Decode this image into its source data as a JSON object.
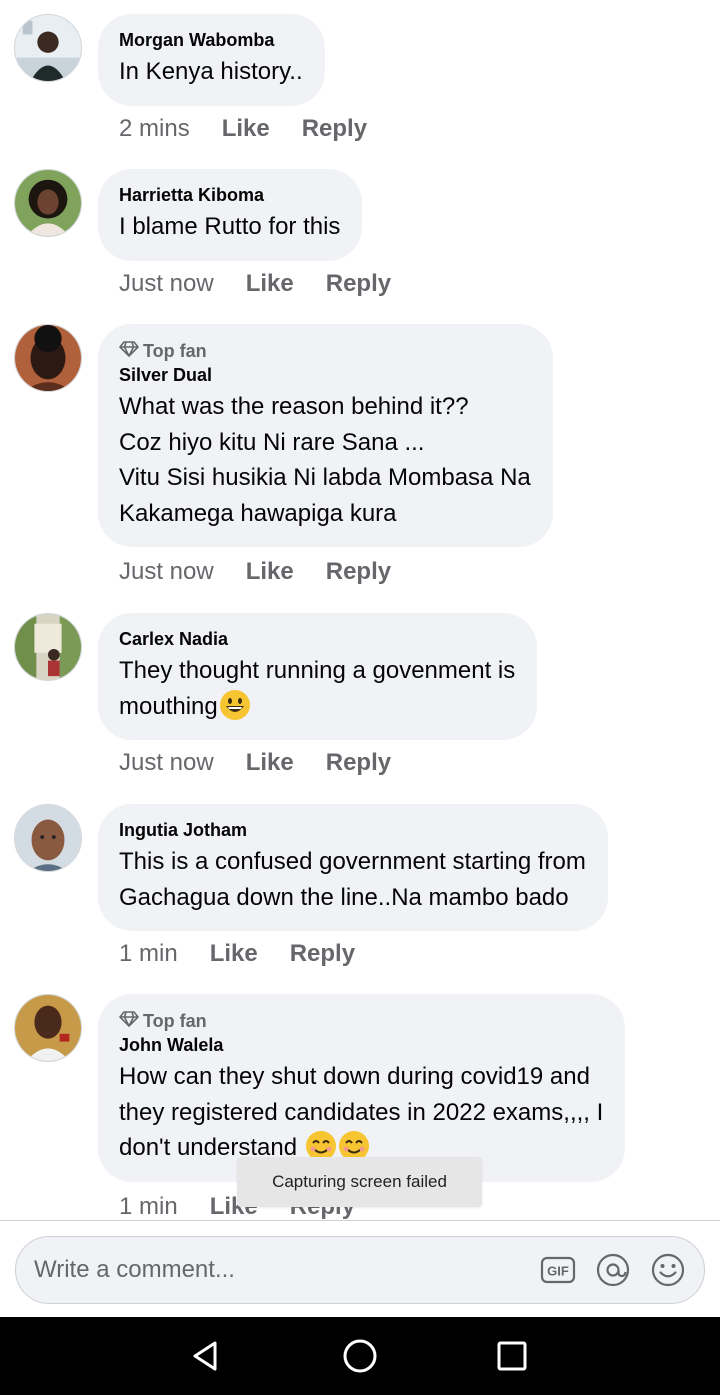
{
  "comments": [
    {
      "author": "Morgan Wabomba",
      "text": "In Kenya history..",
      "time": "2 mins",
      "like": "Like",
      "reply": "Reply"
    },
    {
      "author": "Harrietta Kiboma",
      "text": "I blame Rutto for this",
      "time": "Just now",
      "like": "Like",
      "reply": "Reply"
    },
    {
      "badge": "Top fan",
      "author": "Silver Dual",
      "text": "What was the reason behind it??\nCoz hiyo kitu Ni rare Sana ...\nVitu Sisi husikia Ni labda Mombasa Na\nKakamega hawapiga kura",
      "time": "Just now",
      "like": "Like",
      "reply": "Reply"
    },
    {
      "author": "Carlex Nadia",
      "text": "They thought running a govenment is\nmouthing",
      "time": "Just now",
      "like": "Like",
      "reply": "Reply"
    },
    {
      "author": "Ingutia Jotham",
      "text": "This is a confused government starting from\nGachagua down the line..Na mambo bado",
      "time": "1 min",
      "like": "Like",
      "reply": "Reply"
    },
    {
      "badge": "Top fan",
      "author": "John Walela",
      "text": "How can they shut down during covid19 and\nthey registered candidates in 2022 exams,,,, I\ndon't understand",
      "time": "1 min",
      "like": "Like",
      "reply": "Reply"
    }
  ],
  "toast": "Capturing screen failed",
  "composer": {
    "placeholder": "Write a comment...",
    "icons": [
      "gif-icon",
      "mention-icon",
      "emoji-icon"
    ]
  },
  "navigation": [
    "back-icon",
    "home-icon",
    "recents-icon"
  ],
  "colors": {
    "bubble": "#f0f2f5",
    "meta": "#65676b",
    "text": "#050505",
    "navbar": "#000000"
  }
}
